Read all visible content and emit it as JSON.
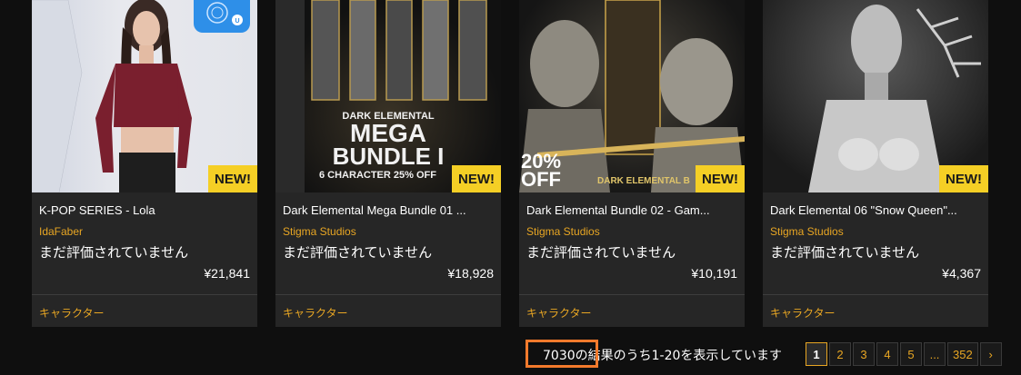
{
  "products": [
    {
      "title": "K-POP SERIES - Lola",
      "author": "IdaFaber",
      "rating_text": "まだ評価されていません",
      "price": "¥21,841",
      "category": "キャラクター",
      "badge": "NEW!",
      "thumb_icon": "unreal-engine-icon"
    },
    {
      "title": "Dark Elemental Mega Bundle 01 ...",
      "author": "Stigma Studios",
      "rating_text": "まだ評価されていません",
      "price": "¥18,928",
      "category": "キャラクター",
      "badge": "NEW!",
      "promo_line1": "DARK ELEMENTAL",
      "promo_line2": "MEGA",
      "promo_line3": "BUNDLE I",
      "promo_line4": "6 CHARACTER 25% OFF"
    },
    {
      "title": "Dark Elemental Bundle 02 - Gam...",
      "author": "Stigma Studios",
      "rating_text": "まだ評価されていません",
      "price": "¥10,191",
      "category": "キャラクター",
      "badge": "NEW!",
      "promo_sale_1": "20%",
      "promo_sale_2": "OFF",
      "promo_caption": "DARK ELEMENTAL B"
    },
    {
      "title": "Dark Elemental 06 \"Snow Queen\"...",
      "author": "Stigma Studios",
      "rating_text": "まだ評価されていません",
      "price": "¥4,367",
      "category": "キャラクター",
      "badge": "NEW!"
    }
  ],
  "results": {
    "text": "7030の結果のうち1-20を表示しています"
  },
  "pagination": {
    "pages": [
      "1",
      "2",
      "3",
      "4",
      "5",
      "...",
      "352"
    ],
    "current": "1",
    "next": "›"
  },
  "colors": {
    "accent": "#e8a623",
    "badge": "#f5cf25",
    "highlight": "#f37a2c"
  }
}
